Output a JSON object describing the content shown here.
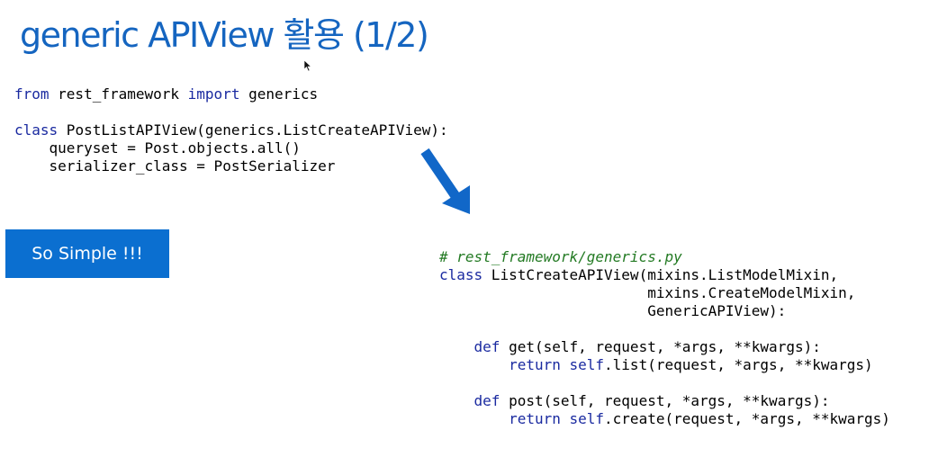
{
  "title": "generic APIView 활용 (1/2)",
  "badge": "So Simple !!!",
  "code_top": [
    [
      {
        "t": "from",
        "c": "kw"
      },
      {
        "t": " rest_framework "
      },
      {
        "t": "import",
        "c": "kw"
      },
      {
        "t": " generics"
      }
    ],
    [],
    [
      {
        "t": "class",
        "c": "kw"
      },
      {
        "t": " PostListAPIView(generics.ListCreateAPIView):"
      }
    ],
    [
      {
        "t": "    queryset = Post.objects.all()"
      }
    ],
    [
      {
        "t": "    serializer_class = PostSerializer"
      }
    ]
  ],
  "code_bottom": [
    [
      {
        "t": "# rest_framework/generics.py",
        "c": "cm"
      }
    ],
    [
      {
        "t": "class",
        "c": "kw"
      },
      {
        "t": " ListCreateAPIView(mixins.ListModelMixin,"
      }
    ],
    [
      {
        "t": "                        mixins.CreateModelMixin,"
      }
    ],
    [
      {
        "t": "                        GenericAPIView):"
      }
    ],
    [],
    [
      {
        "t": "    "
      },
      {
        "t": "def",
        "c": "kw"
      },
      {
        "t": " get(self, request, *args, **kwargs):"
      }
    ],
    [
      {
        "t": "        "
      },
      {
        "t": "return",
        "c": "kw"
      },
      {
        "t": " "
      },
      {
        "t": "self",
        "c": "kw"
      },
      {
        "t": ".list(request, *args, **kwargs)"
      }
    ],
    [],
    [
      {
        "t": "    "
      },
      {
        "t": "def",
        "c": "kw"
      },
      {
        "t": " post(self, request, *args, **kwargs):"
      }
    ],
    [
      {
        "t": "        "
      },
      {
        "t": "return",
        "c": "kw"
      },
      {
        "t": " "
      },
      {
        "t": "self",
        "c": "kw"
      },
      {
        "t": ".create(request, *args, **kwargs)"
      }
    ]
  ],
  "colors": {
    "title": "#1565c0",
    "badge_bg": "#0b6fd0",
    "arrow": "#1167c8",
    "keyword": "#1a2aa0",
    "comment": "#237a23"
  },
  "icons": {
    "arrow": "down-right-arrow-icon",
    "cursor": "mouse-cursor-icon"
  }
}
